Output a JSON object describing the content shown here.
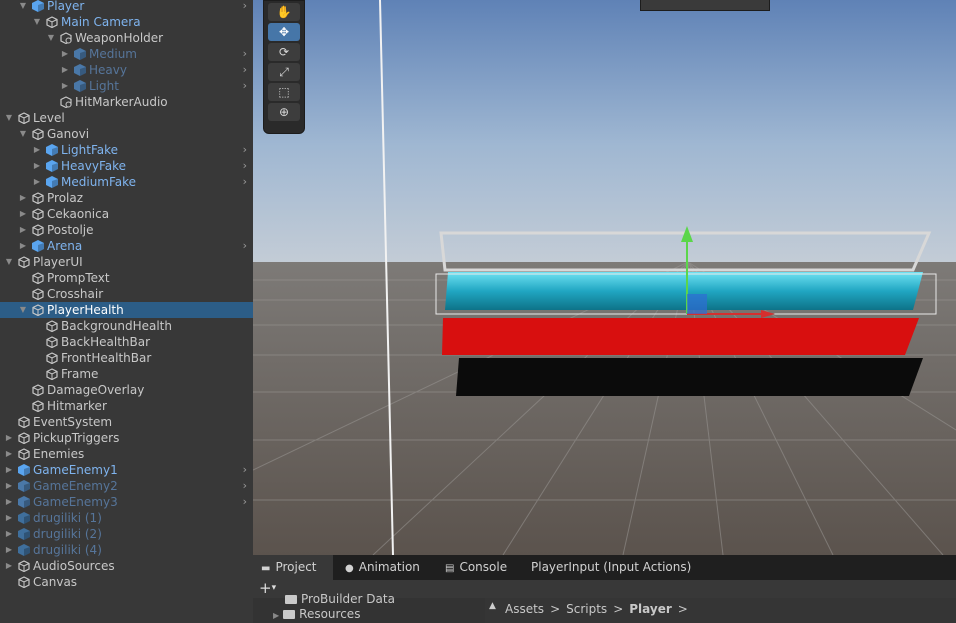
{
  "hierarchy": {
    "items": [
      {
        "label": "Player",
        "indent": 2,
        "expanded": true,
        "type": "prefab",
        "more": true
      },
      {
        "label": "Main Camera",
        "indent": 3,
        "expanded": true,
        "type": "go",
        "blue": true
      },
      {
        "label": "WeaponHolder",
        "indent": 4,
        "expanded": true,
        "type": "go-special"
      },
      {
        "label": "Medium",
        "indent": 5,
        "expanded": false,
        "type": "prefab-dim",
        "more": true
      },
      {
        "label": "Heavy",
        "indent": 5,
        "expanded": false,
        "type": "prefab-dim",
        "more": true
      },
      {
        "label": "Light",
        "indent": 5,
        "expanded": false,
        "type": "prefab-dim",
        "more": true
      },
      {
        "label": "HitMarkerAudio",
        "indent": 4,
        "expanded": null,
        "type": "go-special"
      },
      {
        "label": "Level",
        "indent": 1,
        "expanded": true,
        "type": "go"
      },
      {
        "label": "Ganovi",
        "indent": 2,
        "expanded": true,
        "type": "go"
      },
      {
        "label": "LightFake",
        "indent": 3,
        "expanded": false,
        "type": "prefab",
        "more": true
      },
      {
        "label": "HeavyFake",
        "indent": 3,
        "expanded": false,
        "type": "prefab",
        "more": true
      },
      {
        "label": "MediumFake",
        "indent": 3,
        "expanded": false,
        "type": "prefab",
        "more": true
      },
      {
        "label": "Prolaz",
        "indent": 2,
        "expanded": false,
        "type": "go"
      },
      {
        "label": "Cekaonica",
        "indent": 2,
        "expanded": false,
        "type": "go"
      },
      {
        "label": "Postolje",
        "indent": 2,
        "expanded": false,
        "type": "go"
      },
      {
        "label": "Arena",
        "indent": 2,
        "expanded": false,
        "type": "prefab",
        "more": true
      },
      {
        "label": "PlayerUI",
        "indent": 1,
        "expanded": true,
        "type": "go"
      },
      {
        "label": "PrompText",
        "indent": 2,
        "expanded": null,
        "type": "go"
      },
      {
        "label": "Crosshair",
        "indent": 2,
        "expanded": null,
        "type": "go"
      },
      {
        "label": "PlayerHealth",
        "indent": 2,
        "expanded": true,
        "type": "go",
        "selected": true
      },
      {
        "label": "BackgroundHealth",
        "indent": 3,
        "expanded": null,
        "type": "go"
      },
      {
        "label": "BackHealthBar",
        "indent": 3,
        "expanded": null,
        "type": "go"
      },
      {
        "label": "FrontHealthBar",
        "indent": 3,
        "expanded": null,
        "type": "go"
      },
      {
        "label": "Frame",
        "indent": 3,
        "expanded": null,
        "type": "go"
      },
      {
        "label": "DamageOverlay",
        "indent": 2,
        "expanded": null,
        "type": "go"
      },
      {
        "label": "Hitmarker",
        "indent": 2,
        "expanded": null,
        "type": "go"
      },
      {
        "label": "EventSystem",
        "indent": 1,
        "expanded": null,
        "type": "go"
      },
      {
        "label": "PickupTriggers",
        "indent": 1,
        "expanded": false,
        "type": "go"
      },
      {
        "label": "Enemies",
        "indent": 1,
        "expanded": false,
        "type": "go"
      },
      {
        "label": "GameEnemy1",
        "indent": 1,
        "expanded": false,
        "type": "prefab",
        "more": true
      },
      {
        "label": "GameEnemy2",
        "indent": 1,
        "expanded": false,
        "type": "prefab-dim",
        "more": true
      },
      {
        "label": "GameEnemy3",
        "indent": 1,
        "expanded": false,
        "type": "prefab-dim",
        "more": true
      },
      {
        "label": "drugiliki (1)",
        "indent": 1,
        "expanded": false,
        "type": "prefab-dim2"
      },
      {
        "label": "drugiliki (2)",
        "indent": 1,
        "expanded": false,
        "type": "prefab-dim2"
      },
      {
        "label": "drugiliki (4)",
        "indent": 1,
        "expanded": false,
        "type": "prefab-dim2"
      },
      {
        "label": "AudioSources",
        "indent": 1,
        "expanded": false,
        "type": "go"
      },
      {
        "label": "Canvas",
        "indent": 1,
        "expanded": null,
        "type": "go"
      }
    ]
  },
  "scene_tools": [
    {
      "name": "hand-tool",
      "glyph": "✋",
      "active": false
    },
    {
      "name": "move-tool",
      "glyph": "✥",
      "active": true
    },
    {
      "name": "rotate-tool",
      "glyph": "⟳",
      "active": false
    },
    {
      "name": "scale-tool",
      "glyph": "⤢",
      "active": false
    },
    {
      "name": "rect-tool",
      "glyph": "⬚",
      "active": false
    },
    {
      "name": "transform-tool",
      "glyph": "⊕",
      "active": false
    }
  ],
  "bottom_panel": {
    "tabs": [
      {
        "label": "Project",
        "icon": "folder-icon",
        "active": true
      },
      {
        "label": "Animation",
        "icon": "animation-icon",
        "active": false
      },
      {
        "label": "Console",
        "icon": "console-icon",
        "active": false
      },
      {
        "label": "PlayerInput (Input Actions)",
        "icon": "",
        "active": false
      }
    ],
    "add_glyph": "+",
    "add_caret": "▾",
    "folders": [
      "ProBuilder Data",
      "Resources"
    ],
    "breadcrumb": {
      "items": [
        "Assets",
        "Scripts",
        "Player"
      ],
      "separator": ">"
    }
  },
  "colors": {
    "selection": "#2c5d87",
    "prefab_text": "#7fb4ef",
    "health_front": "#2fb6cf",
    "health_back": "#d80f0f",
    "health_bg": "#0a0a0a",
    "gizmo_y": "#5bd64a",
    "gizmo_x": "#d62f2f",
    "gizmo_z": "#2f6cd6"
  }
}
